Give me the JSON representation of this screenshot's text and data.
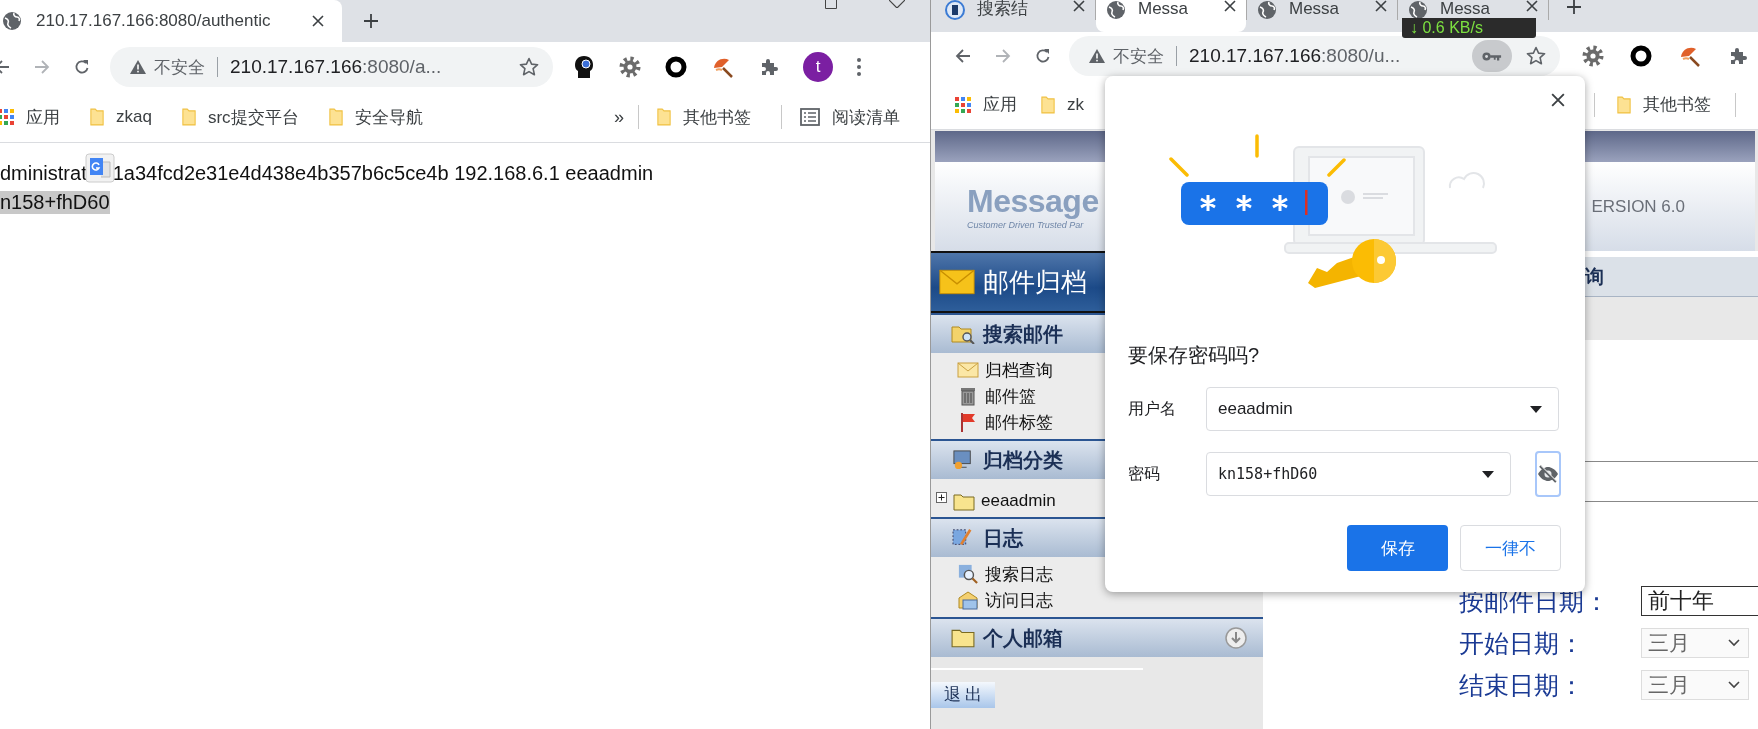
{
  "left_window": {
    "tab": {
      "title": "210.17.167.166:8080/authentic",
      "selected": true
    },
    "omnibox": {
      "security_label": "不安全",
      "url_host": "210.17.167.166",
      "url_rest": ":8080/a..."
    },
    "avatar": "t",
    "bookmarks": [
      {
        "kind": "apps",
        "label": "应用"
      },
      {
        "kind": "folder",
        "label": "zkaq"
      },
      {
        "kind": "folder",
        "label": "src提交平台"
      },
      {
        "kind": "folder",
        "label": "安全导航"
      }
    ],
    "overflow": "»",
    "end_bookmarks": [
      {
        "kind": "folder",
        "label": "其他书签"
      },
      {
        "kind": "reading_list",
        "label": "阅读清单"
      }
    ],
    "page": {
      "line_1_before": "dministrat",
      "line_1_after": "1a34fcd2e31e4d438e4b357b6c5ce4b 192.168.6.1 eeaadmin",
      "line_2": {
        "text": "n158+fhD60",
        "selected": true
      }
    }
  },
  "right_window": {
    "tabs": [
      {
        "title": "搜索结",
        "kind": "favicon",
        "selected": false
      },
      {
        "title": "Messa",
        "kind": "globe",
        "selected": true
      },
      {
        "title": "Messa",
        "kind": "globe",
        "selected": false
      },
      {
        "title": "Messa",
        "kind": "globe",
        "selected": false
      }
    ],
    "speed_indicator": "↓ 0.6 KB/s",
    "omnibox": {
      "security_label": "不安全",
      "url_host": "210.17.167.166",
      "url_rest": ":8080/u..."
    },
    "bookmarks": [
      {
        "kind": "apps",
        "label": "应用"
      },
      {
        "kind": "folder",
        "label": "zk"
      }
    ],
    "end_bookmarks": [
      {
        "kind": "folder",
        "label": "其他书签"
      }
    ],
    "page": {
      "logo": "Message",
      "tagline": "Customer Driven Trusted Par",
      "version": "ERSION 6.0",
      "sidebar": {
        "title": "邮件归档",
        "sections": [
          {
            "title": "搜索邮件",
            "kind": "search_folder",
            "items": [
              {
                "label": "归档查询",
                "kind": "envelope"
              },
              {
                "label": "邮件篮",
                "kind": "trash"
              },
              {
                "label": "邮件标签",
                "kind": "flag"
              }
            ]
          },
          {
            "title": "归档分类",
            "kind": "monitor",
            "tree": [
              {
                "label": "eeaadmin",
                "expanded": false
              }
            ]
          },
          {
            "title": "日志",
            "kind": "log",
            "items": [
              {
                "label": "搜索日志",
                "kind": "magnifier"
              },
              {
                "label": "访问日志",
                "kind": "visit"
              }
            ]
          },
          {
            "title": "个人邮箱",
            "kind": "folder",
            "toggle": true
          }
        ],
        "logout": "退 出"
      },
      "header_tail": "询",
      "form": [
        {
          "label": "按邮件日期：",
          "value": "前十年",
          "kind": "text"
        },
        {
          "label": "开始日期：",
          "value": "三月",
          "kind": "select"
        },
        {
          "label": "结束日期：",
          "value": "三月",
          "kind": "select"
        }
      ]
    },
    "dialog": {
      "title": "要保存密码吗?",
      "fields": [
        {
          "label": "用户名",
          "value": "eeaadmin",
          "kind": "username"
        },
        {
          "label": "密码",
          "value": "kn158+fhD60",
          "kind": "password",
          "reveal_button": true
        }
      ],
      "buttons": [
        {
          "label": "保存",
          "kind": "primary"
        },
        {
          "label": "一律不",
          "kind": "secondary"
        }
      ]
    }
  }
}
